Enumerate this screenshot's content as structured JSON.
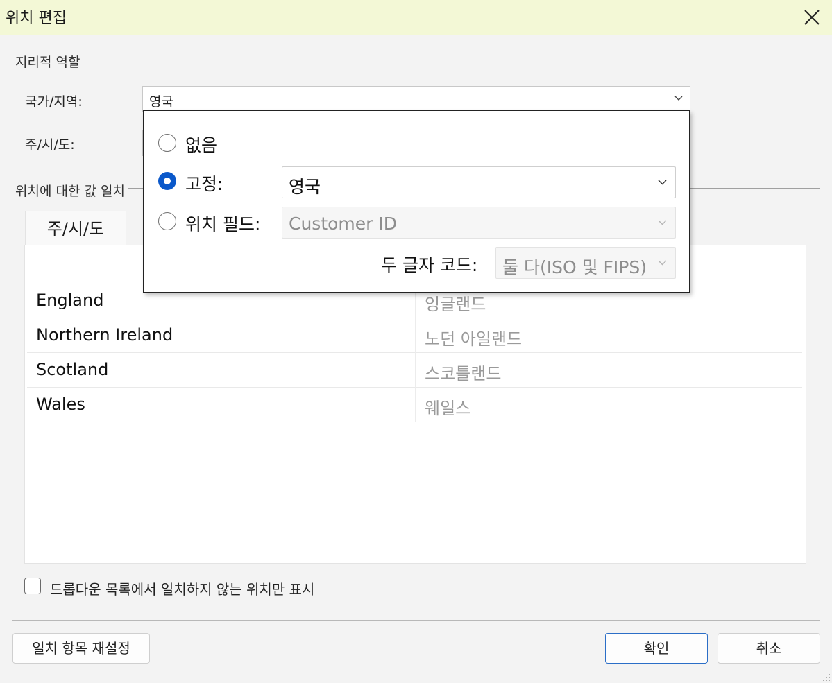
{
  "window": {
    "title": "위치 편집"
  },
  "geo_role": {
    "section_label": "지리적 역할",
    "country_label": "국가/지역:",
    "country_value": "영국",
    "state_label": "주/시/도:"
  },
  "match_section": {
    "label": "위치에 대한 값 일치"
  },
  "tabs": [
    {
      "label": "주/시/도"
    }
  ],
  "table": {
    "rows": [
      {
        "name": "England",
        "match": "잉글랜드"
      },
      {
        "name": "Northern Ireland",
        "match": "노던 아일랜드"
      },
      {
        "name": "Scotland",
        "match": "스코틀랜드"
      },
      {
        "name": "Wales",
        "match": "웨일스"
      }
    ]
  },
  "popup": {
    "option_none": "없음",
    "option_fixed": "고정:",
    "fixed_value": "영국",
    "option_field": "위치 필드:",
    "field_value": "Customer ID",
    "code_label": "두 글자 코드:",
    "code_value": "둘 다(ISO 및 FIPS)",
    "selected": "fixed"
  },
  "checkbox": {
    "label": "드롭다운 목록에서 일치하지 않는 위치만 표시",
    "checked": false
  },
  "buttons": {
    "reset": "일치 항목 재설정",
    "ok": "확인",
    "cancel": "취소"
  },
  "colors": {
    "title_bar": "#f3f8d6",
    "accent": "#0a58ca",
    "primary_border": "#2b6ec7"
  }
}
